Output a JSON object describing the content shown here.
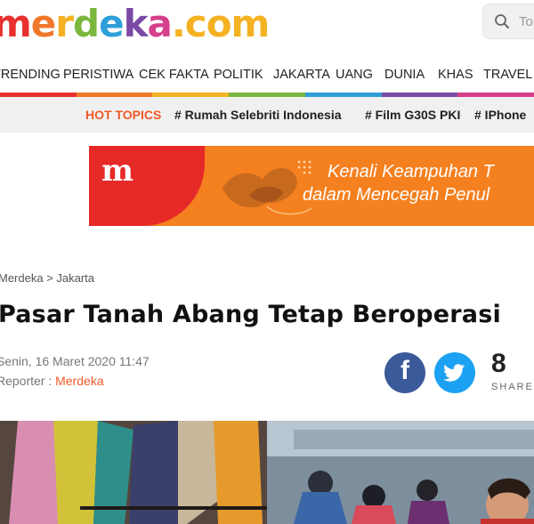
{
  "header": {
    "logo_text": "merdeka.com",
    "logo_letters": [
      {
        "ch": "m",
        "color": "#e8312f"
      },
      {
        "ch": "e",
        "color": "#f0782a"
      },
      {
        "ch": "r",
        "color": "#f4b223"
      },
      {
        "ch": "d",
        "color": "#7bb73e"
      },
      {
        "ch": "e",
        "color": "#2e9fd8"
      },
      {
        "ch": "k",
        "color": "#7a4aa6"
      },
      {
        "ch": "a",
        "color": "#d63f8c"
      },
      {
        "ch": ".com",
        "color": "#f4b223"
      }
    ],
    "search_placeholder": "Topik",
    "search_icon": "search-icon"
  },
  "nav": {
    "items": [
      "TRENDING",
      "PERISTIWA",
      "CEK FAKTA",
      "POLITIK",
      "JAKARTA",
      "UANG",
      "DUNIA",
      "KHAS",
      "TRAVEL"
    ],
    "bar_colors": [
      "#e8312f",
      "#f0782a",
      "#f4b223",
      "#7bb73e",
      "#2e9fd8",
      "#7a4aa6",
      "#d63f8c"
    ]
  },
  "hot_topics": {
    "label": "HOT TOPICS",
    "items": [
      "# Rumah Selebriti Indonesia",
      "# Film G30S PKI",
      "# IPhone"
    ]
  },
  "banner": {
    "logo": "m",
    "line1": "Kenali Keampuhan T",
    "line2": "dalam Mencegah Penul"
  },
  "article": {
    "breadcrumb": "Merdeka > Jakarta",
    "title": "Pasar Tanah Abang Tetap Beroperasi",
    "date": "Senin, 16 Maret 2020 11:47",
    "reporter_label": "Reporter : ",
    "reporter_name": "Merdeka"
  },
  "share": {
    "facebook_icon": "facebook-icon",
    "twitter_icon": "twitter-icon",
    "count": "8",
    "label": "SHARES"
  },
  "colors": {
    "accent": "#ef5a28",
    "facebook": "#3b5a9a",
    "twitter": "#1da1f2",
    "banner_orange": "#f5801f",
    "banner_red": "#e62a27"
  }
}
